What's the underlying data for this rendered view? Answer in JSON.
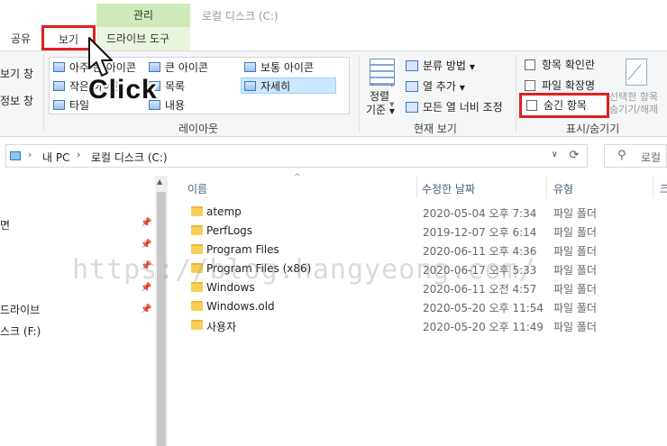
{
  "window": {
    "title": "로컬 디스크 (C:)",
    "context_tab": "관리"
  },
  "tabs": {
    "share": "공유",
    "view": "보기",
    "drive_tools": "드라이브 도구"
  },
  "ribbon": {
    "pane_stub_1": "보기 창",
    "pane_stub_2": "정보 창",
    "layout": {
      "items": [
        {
          "label": "아주 큰 아이콘"
        },
        {
          "label": "큰 아이콘"
        },
        {
          "label": "보통 아이콘"
        },
        {
          "label": "작은 아이콘"
        },
        {
          "label": "목록"
        },
        {
          "label": "자세히"
        },
        {
          "label": "타일"
        },
        {
          "label": "내용"
        }
      ],
      "selected": "자세히",
      "group_label": "레이아웃"
    },
    "current_view": {
      "sort_label_line1": "정렬",
      "sort_label_line2": "기준",
      "group_by": "분류 방법",
      "add_column": "열 추가",
      "fit_columns": "모든 열 너비 조정",
      "group_label": "현재 보기"
    },
    "show_hide": {
      "item_checkboxes": "항목 확인란",
      "file_extensions": "파일 확장명",
      "hidden_items": "숨긴 항목",
      "hide_selected_line1": "선택한 항목",
      "hide_selected_line2": "숨기기/해제",
      "group_label": "표시/숨기기"
    }
  },
  "address": {
    "segments": [
      "내 PC",
      "로컬 디스크 (C:)"
    ],
    "search_placeholder": "로컬"
  },
  "nav": {
    "items": [
      "면",
      "드라이브",
      "스크 (F:)"
    ]
  },
  "columns": {
    "name": "이름",
    "modified": "수정한 날짜",
    "type": "유형",
    "size": "크"
  },
  "files": [
    {
      "name": "atemp",
      "date": "2020-05-04 오후 7:34",
      "type": "파일 폴더"
    },
    {
      "name": "PerfLogs",
      "date": "2019-12-07 오후 6:14",
      "type": "파일 폴더"
    },
    {
      "name": "Program Files",
      "date": "2020-06-11 오후 4:36",
      "type": "파일 폴더"
    },
    {
      "name": "Program Files (x86)",
      "date": "2020-06-17 오후 5:33",
      "type": "파일 폴더"
    },
    {
      "name": "Windows",
      "date": "2020-06-11 오전 4:57",
      "type": "파일 폴더"
    },
    {
      "name": "Windows.old",
      "date": "2020-05-20 오후 11:54",
      "type": "파일 폴더"
    },
    {
      "name": "사용자",
      "date": "2020-05-20 오후 11:49",
      "type": "파일 폴더"
    }
  ],
  "overlay": {
    "click_text": "Click",
    "watermark": "https://blog.hangyeong.com/"
  },
  "colors": {
    "highlight_red": "#e02020",
    "manage_tab_green": "#cfe9b8",
    "selected_blue": "#cce8ff",
    "folder_yellow": "#f6cf58"
  }
}
